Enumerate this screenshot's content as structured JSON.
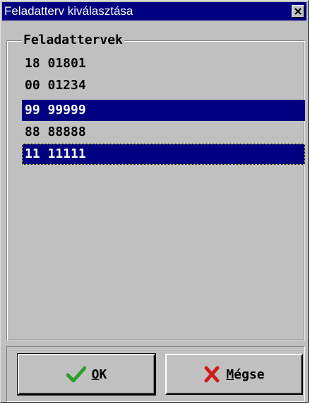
{
  "window": {
    "title": "Feladatterv kiválasztása"
  },
  "group": {
    "title": "Feladattervek"
  },
  "list": {
    "items": [
      {
        "label": "18 01801",
        "selected": false
      },
      {
        "label": "00 01234",
        "selected": false
      },
      {
        "label": "99 99999",
        "selected": true
      },
      {
        "label": "88 88888",
        "selected": false
      },
      {
        "label": "11 11111",
        "selected": true,
        "focused": true
      }
    ]
  },
  "buttons": {
    "ok": {
      "label_mnemonic": "O",
      "label_rest": "K",
      "icon": "checkmark-icon"
    },
    "cancel": {
      "label_mnemonic": "M",
      "label_rest": "égse",
      "icon": "x-mark-icon"
    }
  },
  "colors": {
    "titlebar": "#000080",
    "selection": "#000080",
    "face": "#c0c0c0",
    "ok_icon": "#2e9e2e",
    "cancel_icon": "#d11a1a"
  }
}
